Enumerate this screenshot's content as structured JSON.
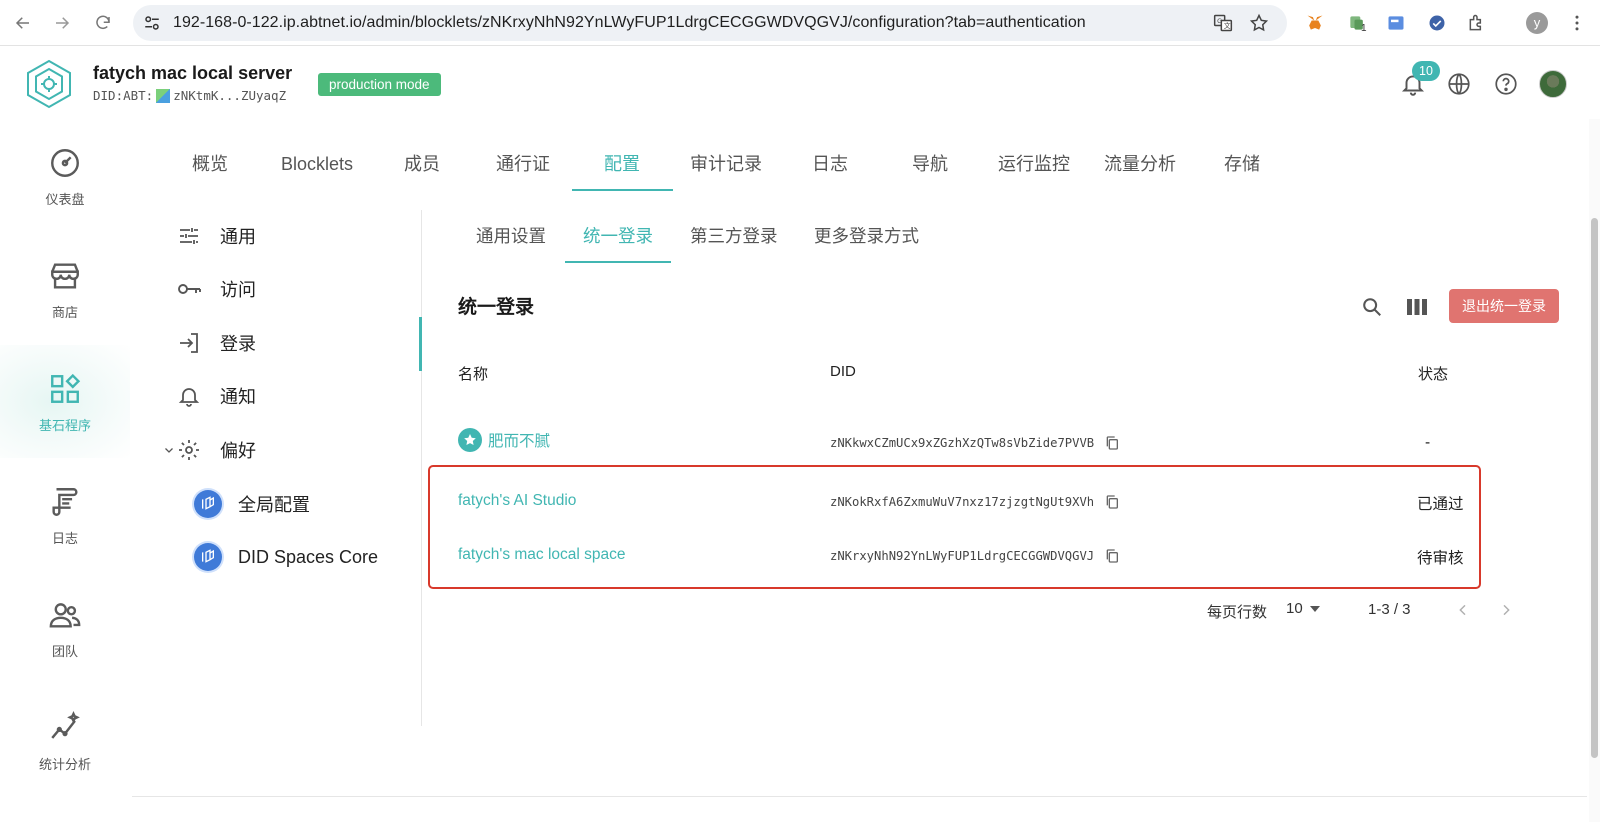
{
  "browser": {
    "url": "192-168-0-122.ip.abtnet.io/admin/blocklets/zNKrxyNhN92YnLWyFUP1LdrgCECGGWDVQGVJ/configuration?tab=authentication",
    "profile_initial": "y",
    "extension_badge": "1"
  },
  "header": {
    "title": "fatych mac local server",
    "did_prefix": "DID:ABT:",
    "did_short": "zNKtmK...ZUyaqZ",
    "mode_badge": "production mode",
    "notification_count": "10"
  },
  "rail": {
    "items": [
      {
        "label": "仪表盘",
        "icon": "dashboard-icon",
        "active": false
      },
      {
        "label": "商店",
        "icon": "store-icon",
        "active": false
      },
      {
        "label": "基石程序",
        "icon": "blocklets-icon",
        "active": true
      },
      {
        "label": "日志",
        "icon": "logs-icon",
        "active": false
      },
      {
        "label": "团队",
        "icon": "team-icon",
        "active": false
      },
      {
        "label": "统计分析",
        "icon": "analytics-icon",
        "active": false
      }
    ]
  },
  "top_tabs": [
    "概览",
    "Blocklets",
    "成员",
    "通行证",
    "配置",
    "审计记录",
    "日志",
    "导航",
    "运行监控",
    "流量分析",
    "存储"
  ],
  "top_tab_active": "配置",
  "subnav": {
    "items": [
      {
        "label": "通用",
        "icon": "sliders-icon"
      },
      {
        "label": "访问",
        "icon": "key-icon"
      },
      {
        "label": "登录",
        "icon": "login-icon"
      },
      {
        "label": "通知",
        "icon": "bell-icon"
      },
      {
        "label": "偏好",
        "icon": "gear-icon"
      }
    ],
    "active": "登录",
    "preference_children": [
      {
        "label": "全局配置",
        "icon": "did-spaces-icon"
      },
      {
        "label": "DID Spaces Core",
        "icon": "did-spaces-icon"
      }
    ]
  },
  "sub_tabs": [
    "通用设置",
    "统一登录",
    "第三方登录",
    "更多登录方式"
  ],
  "sub_tab_active": "统一登录",
  "table": {
    "title": "统一登录",
    "exit_button": "退出统一登录",
    "columns": {
      "name": "名称",
      "did": "DID",
      "status": "状态"
    },
    "rows": [
      {
        "name": "肥而不腻",
        "did": "zNKkwxCZmUCx9xZGzhXzQTw8sVbZide7PVVB",
        "status": "-",
        "starred": true
      },
      {
        "name": "fatych's AI Studio",
        "did": "zNKokRxfA6ZxmuWuV7nxz17zjzgtNgUt9XVh",
        "status": "已通过",
        "starred": false
      },
      {
        "name": "fatych's mac local space",
        "did": "zNKrxyNhN92YnLWyFUP1LdrgCECGGWDVQGVJ",
        "status": "待审核",
        "starred": false
      }
    ]
  },
  "pagination": {
    "rows_per_page_label": "每页行数",
    "rows_per_page": "10",
    "range": "1-3 / 3"
  },
  "colors": {
    "accent": "#41b6b2",
    "badge_green": "#4cba7b",
    "danger_button": "#e07470",
    "highlight_box": "#d8392b"
  }
}
